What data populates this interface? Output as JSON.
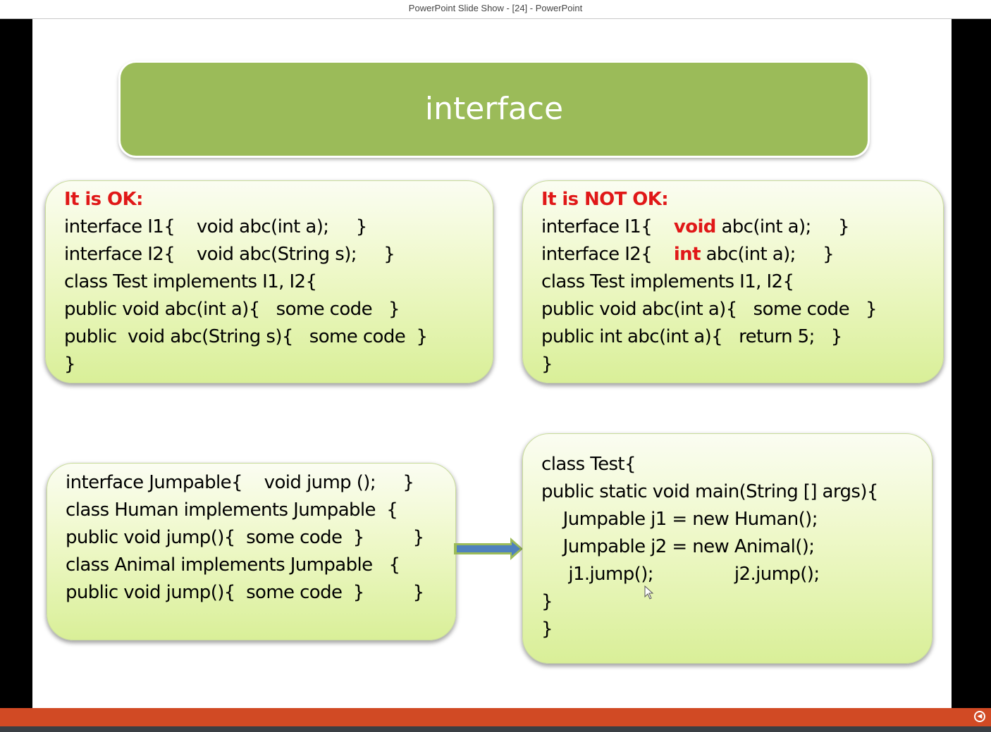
{
  "window": {
    "title": "PowerPoint Slide Show - [24] - PowerPoint"
  },
  "slide": {
    "title": "interface",
    "ok_box": {
      "heading": "It is OK:",
      "lines": [
        "interface I1{    void abc(int a);     }",
        "interface I2{    void abc(String s);     }",
        "class Test implements I1, I2{",
        "public void abc(int a){   some code   }",
        "public  void abc(String s){   some code  }",
        "}"
      ]
    },
    "not_ok_box": {
      "heading": "It is NOT OK:",
      "line1": {
        "pre": "interface I1{    ",
        "kw": "void",
        "post": " abc(int a);     }"
      },
      "line2": {
        "pre": "interface I2{    ",
        "kw": "int",
        "post": " abc(int a);     }"
      },
      "lines": [
        "class Test implements I1, I2{",
        "public void abc(int a){   some code   }",
        "public int abc(int a){   return 5;   }",
        "}"
      ]
    },
    "jumpable_box": {
      "lines": [
        "interface Jumpable{    void jump ();     }",
        "class Human implements Jumpable  {",
        "public void jump(){  some code  }         }",
        "class Animal implements Jumpable   {",
        "public void jump(){  some code  }         }"
      ]
    },
    "test_box": {
      "lines": [
        "class Test{",
        "public static void main(String [] args){",
        "    Jumpable j1 = new Human();",
        "    Jumpable j2 = new Animal();",
        "     j1.jump();               j2.jump();",
        "}",
        "}"
      ]
    }
  },
  "colors": {
    "banner": "#9bbb59",
    "highlight_red": "#e01818",
    "arrow_blue": "#4f81bd",
    "arrow_green": "#9bbb59",
    "status_bar": "#d14a24"
  }
}
